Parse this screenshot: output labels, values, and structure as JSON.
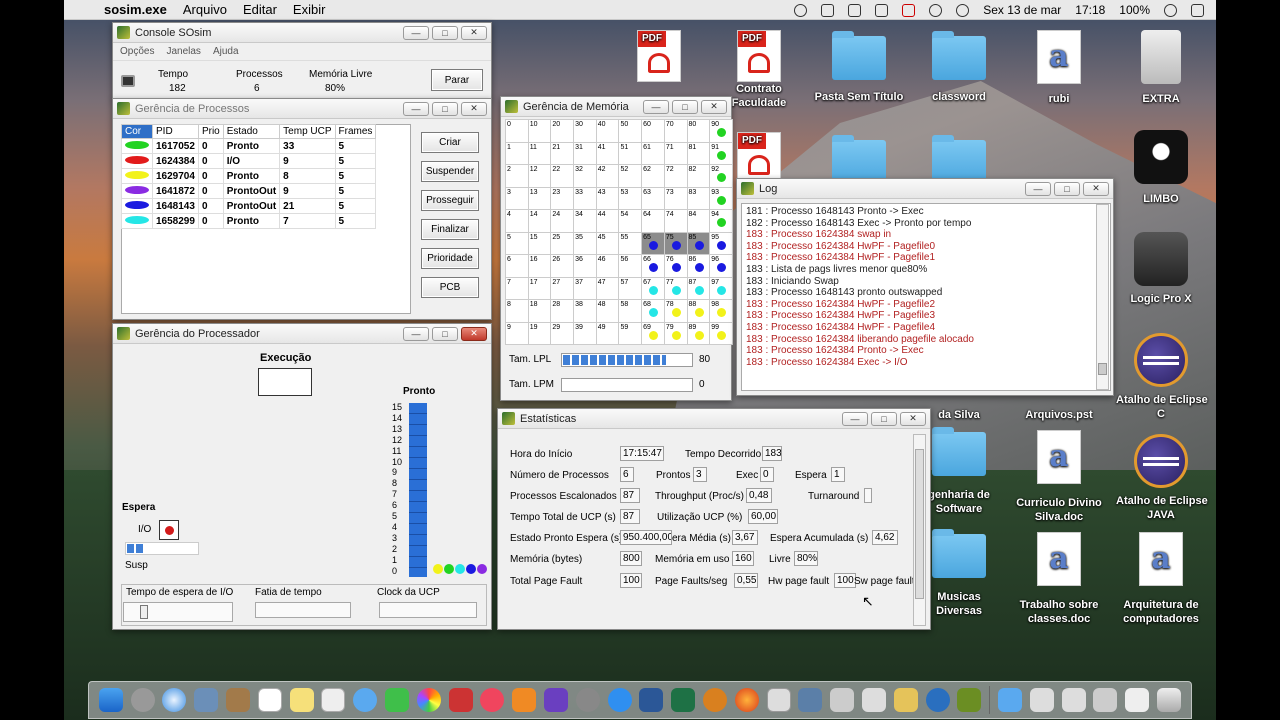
{
  "menubar": {
    "app_name": "sosim.exe",
    "menus": [
      "Arquivo",
      "Editar",
      "Exibir"
    ],
    "date": "Sex 13 de mar",
    "time": "17:18",
    "battery": "100%"
  },
  "console": {
    "title": "Console SOsim",
    "menus": [
      "Opções",
      "Janelas",
      "Ajuda"
    ],
    "tempo_label": "Tempo",
    "tempo_value": "182",
    "processos_label": "Processos",
    "processos_value": "6",
    "memoria_label": "Memória Livre",
    "memoria_value": "80%",
    "parar_label": "Parar"
  },
  "processos": {
    "title": "Gerência de Processos",
    "headers": [
      "Cor",
      "PID",
      "Prio",
      "Estado",
      "Temp UCP",
      "Frames"
    ],
    "rows": [
      {
        "color": "#22d322",
        "pid": "1617052",
        "prio": "0",
        "estado": "Pronto",
        "ucp": "33",
        "frames": "5"
      },
      {
        "color": "#e21b1b",
        "pid": "1624384",
        "prio": "0",
        "estado": "I/O",
        "ucp": "9",
        "frames": "5"
      },
      {
        "color": "#f2f21a",
        "pid": "1629704",
        "prio": "0",
        "estado": "Pronto",
        "ucp": "8",
        "frames": "5"
      },
      {
        "color": "#8a2be2",
        "pid": "1641872",
        "prio": "0",
        "estado": "ProntoOut",
        "ucp": "9",
        "frames": "5"
      },
      {
        "color": "#1a1ae0",
        "pid": "1648143",
        "prio": "0",
        "estado": "ProntoOut",
        "ucp": "21",
        "frames": "5"
      },
      {
        "color": "#25e6e6",
        "pid": "1658299",
        "prio": "0",
        "estado": "Pronto",
        "ucp": "7",
        "frames": "5"
      }
    ],
    "buttons": [
      "Criar",
      "Suspender",
      "Prosseguir",
      "Finalizar",
      "Prioridade",
      "PCB"
    ]
  },
  "processador": {
    "title": "Gerência do Processador",
    "execucao_label": "Execução",
    "pronto_label": "Pronto",
    "queue_numbers": [
      "15",
      "14",
      "13",
      "12",
      "11",
      "10",
      "9",
      "8",
      "7",
      "6",
      "5",
      "4",
      "3",
      "2",
      "1",
      "0"
    ],
    "espera_label": "Espera",
    "io_label": "I/O",
    "susp_label": "Susp",
    "bottom_labels": [
      "Tempo de espera de I/O",
      "Fatia de tempo",
      "Clock da UCP"
    ]
  },
  "memoria": {
    "title": "Gerência de Memória",
    "lpl_label": "Tam. LPL",
    "lpl_value": "80",
    "lpm_label": "Tam. LPM",
    "lpm_value": "0",
    "lpl_fill": 0.8
  },
  "log": {
    "title": "Log",
    "lines": [
      {
        "t": "181 : Processo 1648143 Pronto -> Exec",
        "c": "blk"
      },
      {
        "t": "182 : Processo 1648143 Exec -> Pronto por tempo",
        "c": "blk"
      },
      {
        "t": "183 : Processo 1624384 swap in",
        "c": "red"
      },
      {
        "t": "183 : Processo 1624384 HwPF - Pagefile0",
        "c": "red"
      },
      {
        "t": "183 : Processo 1624384 HwPF - Pagefile1",
        "c": "red"
      },
      {
        "t": "183 : Lista de pags livres menor que80%",
        "c": "blk"
      },
      {
        "t": "183 : Iniciando Swap",
        "c": "blk"
      },
      {
        "t": "183 : Processo 1648143 pronto outswapped",
        "c": "blk"
      },
      {
        "t": "183 : Processo 1624384 HwPF - Pagefile2",
        "c": "red"
      },
      {
        "t": "183 : Processo 1624384 HwPF - Pagefile3",
        "c": "red"
      },
      {
        "t": "183 : Processo 1624384 HwPF - Pagefile4",
        "c": "red"
      },
      {
        "t": "183 : Processo 1624384 liberando pagefile alocado",
        "c": "red"
      },
      {
        "t": "183 : Processo 1624384 Pronto -> Exec",
        "c": "red"
      },
      {
        "t": "183 : Processo 1624384 Exec -> I/O",
        "c": "red"
      }
    ]
  },
  "estatisticas": {
    "title": "Estatísticas",
    "hora_inicio_label": "Hora do Início",
    "hora_inicio": "17:15:47",
    "tempo_decorrido_label": "Tempo Decorrido",
    "tempo_decorrido": "183",
    "num_proc_label": "Número de Processos",
    "num_proc": "6",
    "prontos_label": "Prontos",
    "prontos": "3",
    "exec_label": "Exec",
    "exec": "0",
    "espera_label": "Espera",
    "espera": "1",
    "escalonados_label": "Processos Escalonados",
    "escalonados": "87",
    "throughput_label": "Throughput (Proc/s)",
    "throughput": "0,48",
    "turnaround_label": "Turnaround",
    "turnaround": "",
    "total_ucp_label": "Tempo Total de UCP (s)",
    "total_ucp": "87",
    "util_ucp_label": "Utilização UCP (%)",
    "util_ucp": "60,00",
    "pronto_espera_label": "Estado Pronto Espera (s)",
    "pronto_espera": "950.400,00",
    "media_label": "era Média (s)",
    "media": "3,67",
    "espera_acum_label": "Espera Acumulada (s)",
    "espera_acum": "4,62",
    "memoria_label": "Memória (bytes)",
    "memoria": "800",
    "mem_uso_label": "Memória em uso",
    "mem_uso": "160",
    "livre_label": "Livre",
    "livre": "80%",
    "total_pf_label": "Total Page Fault",
    "total_pf": "100",
    "pf_seg_label": "Page Faults/seg",
    "pf_seg": "0,55",
    "hw_pf_label": "Hw page fault",
    "hw_pf": "100",
    "sw_pf_label": "Sw page fault"
  },
  "desktop": {
    "icons": [
      {
        "label": "",
        "kind": "pdf"
      },
      {
        "label": "Contrato\nFaculdade",
        "kind": "pdf"
      },
      {
        "label": "Pasta Sem Título",
        "kind": "folder"
      },
      {
        "label": "classword",
        "kind": "folder"
      },
      {
        "label": "rubi",
        "kind": "docx"
      },
      {
        "label": "EXTRA",
        "kind": "drive"
      },
      {
        "label": "LIMBO",
        "kind": "limbo"
      },
      {
        "label": "Logic Pro X",
        "kind": "logic"
      },
      {
        "label": "Atalho de Eclipse\nC",
        "kind": "eclipse"
      },
      {
        "label": "Atalho de Eclipse\nJAVA",
        "kind": "eclipse"
      },
      {
        "label": "genharia de\nSoftware",
        "kind": "folder"
      },
      {
        "label": "Curriculo Divino\nSilva.doc",
        "kind": "docx"
      },
      {
        "label": "Musicas\nDiversas",
        "kind": "folder"
      },
      {
        "label": "Trabalho sobre\nclasses.doc",
        "kind": "docx"
      },
      {
        "label": "Arquitetura de\ncomputadores",
        "kind": "docx"
      },
      {
        "label": "da Silva",
        "kind": "text"
      },
      {
        "label": "Arquivos.pst",
        "kind": "text"
      }
    ]
  }
}
